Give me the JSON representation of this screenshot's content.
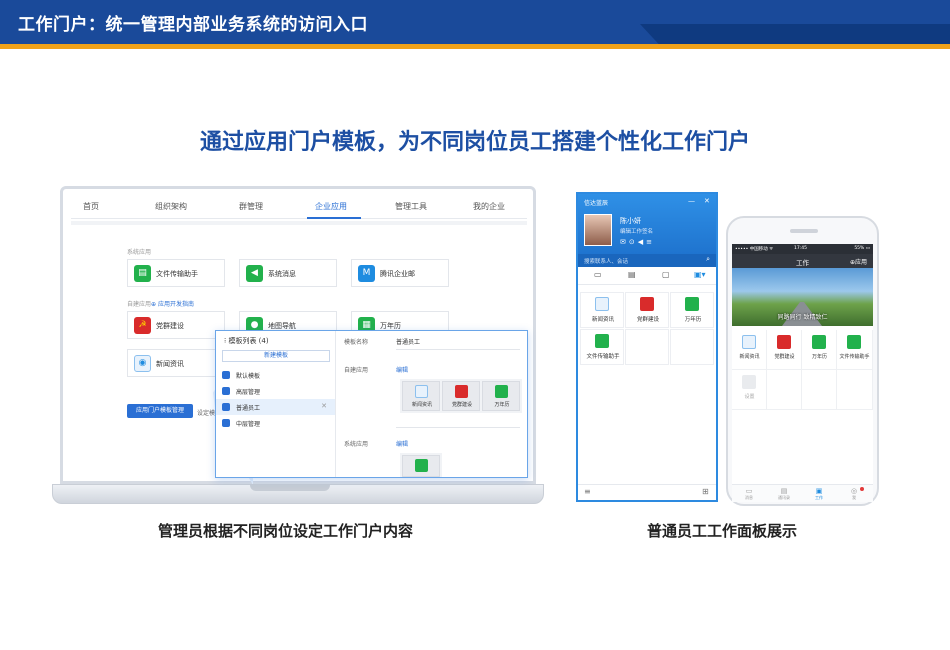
{
  "header": {
    "title": "工作门户：统一管理内部业务系统的访问入口",
    "colors": {
      "bar": "#1a4a9a",
      "stripe": "#f0a21a"
    }
  },
  "headline": "通过应用门户模板，为不同岗位员工搭建个性化工作门户",
  "admin_panel": {
    "nav": [
      "首页",
      "组织架构",
      "群管理",
      "企业应用",
      "管理工具",
      "我的企业"
    ],
    "nav_active": "企业应用",
    "system_section_label": "系统应用",
    "system_apps": [
      {
        "label": "文件传输助手",
        "icon": "file-transfer-icon"
      },
      {
        "label": "系统消息",
        "icon": "message-icon"
      },
      {
        "label": "腾讯企业邮",
        "icon": "mail-icon"
      }
    ],
    "custom_section_label": "自建应用",
    "dev_guide_link": "应用开发指南",
    "custom_apps": [
      {
        "label": "党群建设",
        "icon": "party-icon"
      },
      {
        "label": "地图导航",
        "icon": "map-pin-icon"
      },
      {
        "label": "万年历",
        "icon": "calendar-icon"
      },
      {
        "label": "新闻资讯",
        "icon": "news-icon"
      }
    ],
    "template_button": "应用门户模板管理",
    "template_side_text": "设定模板",
    "popup": {
      "list_title": "模板列表 (4)",
      "new_button": "新建模板",
      "templates": [
        "默认模板",
        "高层管理",
        "普通员工",
        "中层管理"
      ],
      "selected_template": "普通员工",
      "name_label": "模板名称",
      "name_value": "普通员工",
      "custom_label": "自建应用",
      "edit_link": "编辑",
      "custom_apps": [
        "新闻资讯",
        "党群建设",
        "万年历"
      ],
      "system_label": "系统应用",
      "system_edit_link": "编辑"
    }
  },
  "desktop_client": {
    "app_name": "信达蓝辰",
    "user_name": "陈小妍",
    "signature": "编辑工作签名",
    "search_placeholder": "搜索联系人、会话",
    "apps": [
      "新闻资讯",
      "党群建设",
      "万年历",
      "文件传输助手"
    ]
  },
  "phone": {
    "status_left": "••••• 中国移动 ᯤ",
    "status_time": "17:45",
    "status_right": "55% ▭",
    "title": "工作",
    "app_button": "⊕应用",
    "banner_text": "同路同行 致精致仁",
    "apps": [
      "新闻资讯",
      "党群建设",
      "万年历",
      "文件传输助手"
    ],
    "settings_label": "设置",
    "tabs": [
      "消息",
      "通讯录",
      "工作",
      "我"
    ],
    "active_tab": "工作"
  },
  "captions": {
    "left": "管理员根据不同岗位设定工作门户内容",
    "right": "普通员工工作面板展示"
  }
}
